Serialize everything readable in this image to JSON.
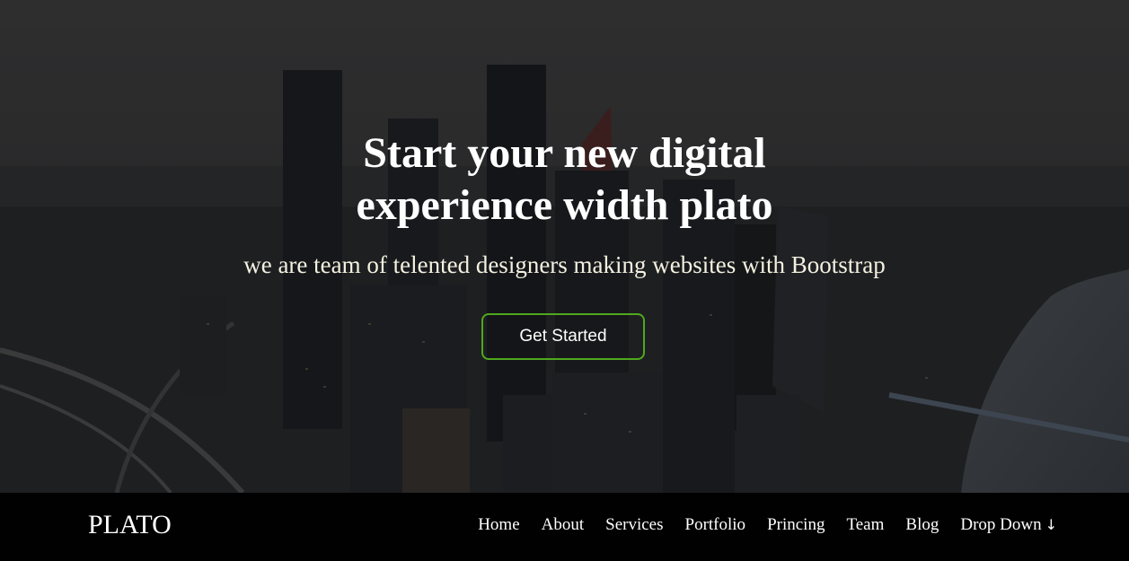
{
  "hero": {
    "title_line1": "Start your new digital",
    "title_line2": "experience width plato",
    "subtitle": "we are team of telented designers making websites with Bootstrap",
    "cta_label": "Get Started"
  },
  "navbar": {
    "brand": "PLATO",
    "items": [
      "Home",
      "About",
      "Services",
      "Portfolio",
      "Princing",
      "Team",
      "Blog",
      "Drop Down"
    ],
    "dropdown_icon": "arrow-down-icon"
  },
  "colors": {
    "cta_border": "#4fa81e",
    "navbar_bg": "#010101",
    "hero_overlay": "#1f1f22"
  }
}
